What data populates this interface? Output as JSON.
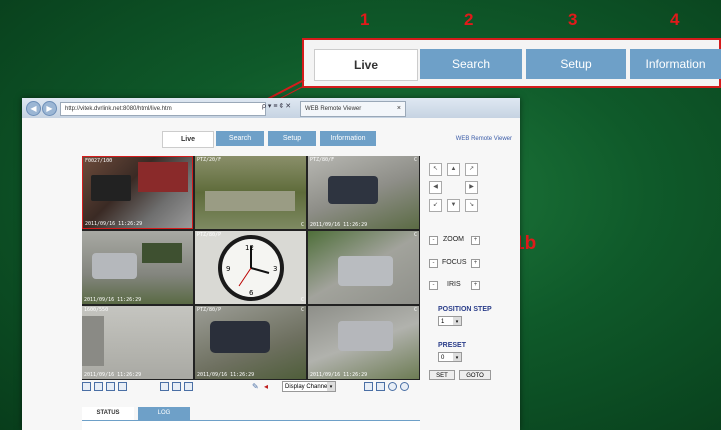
{
  "callout": {
    "numbers": [
      "1",
      "2",
      "3",
      "4"
    ],
    "tabs": [
      "Live",
      "Search",
      "Setup",
      "Information"
    ],
    "label_1b": "1b"
  },
  "browser": {
    "address": "http://vitek.dvrlink.net:8080/html/live.htm",
    "address_controls": "ρ ▾ ≡ ¢ ✕",
    "tab_title": "WEB Remote Viewer",
    "tab_close": "×",
    "back": "◀",
    "forward": "▶"
  },
  "web": {
    "tabs": [
      "Live",
      "Search",
      "Setup",
      "Information"
    ],
    "brand": "WEB Remote Viewer"
  },
  "cameras": [
    {
      "top_label": "F0027/100",
      "bottom_label": "2011/09/16 11:26:29",
      "corner": ""
    },
    {
      "top_label": "PTZ/20/F",
      "bottom_label": "",
      "corner": "C"
    },
    {
      "top_label": "PTZ/80/F",
      "bottom_label": "2011/09/16 11:26:29",
      "corner": "C"
    },
    {
      "top_label": "",
      "bottom_label": "2011/09/16 11:26:29",
      "corner": ""
    },
    {
      "top_label": "PTZ/80/P",
      "bottom_label": "",
      "corner": "C"
    },
    {
      "top_label": "",
      "bottom_label": "",
      "corner": "C"
    },
    {
      "top_label": "1600/550",
      "bottom_label": "2011/09/16 11:26:29",
      "corner": ""
    },
    {
      "top_label": "PTZ/80/P",
      "bottom_label": "2011/09/16 11:26:29",
      "corner": "C"
    },
    {
      "top_label": "",
      "bottom_label": "2011/09/16 11:26:29",
      "corner": "C"
    }
  ],
  "toolbar": {
    "display_select": "Display Channel",
    "select_arrow": "▾"
  },
  "ptz": {
    "arrows": [
      "↖",
      "▲",
      "↗",
      "◀",
      "",
      "▶",
      "↙",
      "▼",
      "↘"
    ],
    "zoom": "ZOOM",
    "focus": "FOCUS",
    "iris": "IRIS",
    "minus": "-",
    "plus": "+",
    "position_step_label": "POSITION STEP",
    "position_step_value": "1",
    "preset_label": "PRESET",
    "preset_value": "0",
    "set": "SET",
    "goto": "GOTO"
  },
  "status_tabs": [
    "STATUS",
    "LOG"
  ],
  "colors": {
    "accent_red": "#e01a1a",
    "tab_blue": "#6ea0c8",
    "bg_green": "#0f5a2a"
  }
}
